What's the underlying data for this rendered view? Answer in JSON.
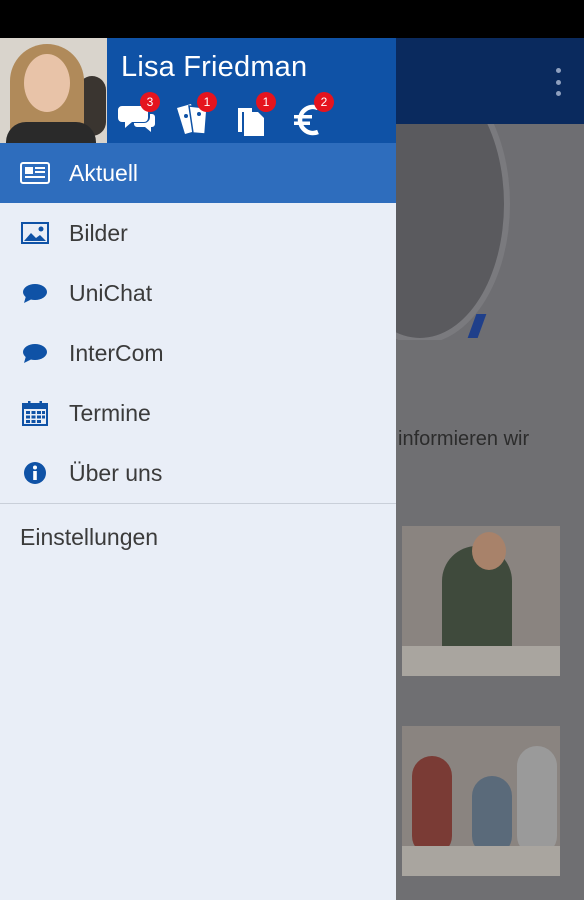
{
  "user": {
    "name": "Lisa Friedman"
  },
  "badges": [
    {
      "icon": "chat-icon",
      "count": "3"
    },
    {
      "icon": "tickets-icon",
      "count": "1"
    },
    {
      "icon": "documents-icon",
      "count": "1"
    },
    {
      "icon": "euro-icon",
      "count": "2"
    }
  ],
  "menu": {
    "items": [
      {
        "label": "Aktuell",
        "icon": "news-icon",
        "active": true
      },
      {
        "label": "Bilder",
        "icon": "image-icon",
        "active": false
      },
      {
        "label": "UniChat",
        "icon": "chat-bubble-icon",
        "active": false
      },
      {
        "label": "InterCom",
        "icon": "chat-bubble-icon",
        "active": false
      },
      {
        "label": "Termine",
        "icon": "calendar-icon",
        "active": false
      },
      {
        "label": "Über uns",
        "icon": "info-icon",
        "active": false
      }
    ],
    "settings_label": "Einstellungen"
  },
  "background": {
    "text_fragment": "informieren wir"
  },
  "colors": {
    "header_blue": "#0f52a6",
    "active_item": "#2e6dbd",
    "drawer_bg": "#e9eef7",
    "icon_blue": "#0f52a6",
    "badge_red": "#e5141e"
  }
}
